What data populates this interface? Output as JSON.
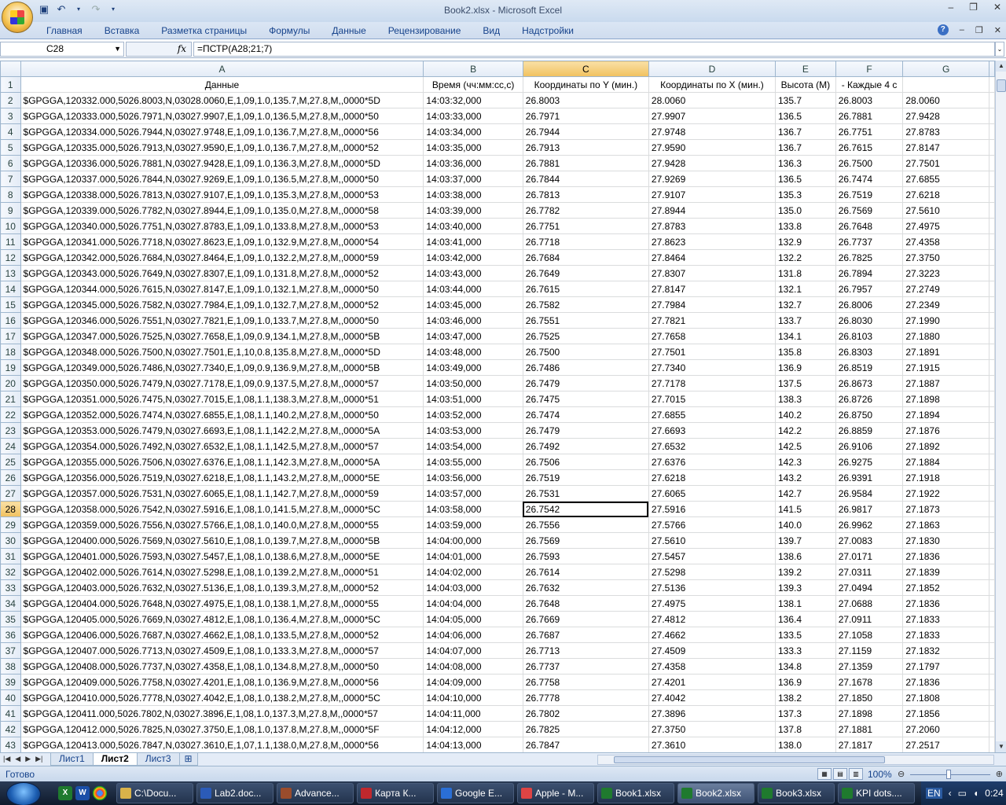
{
  "window": {
    "title": "Book2.xlsx - Microsoft Excel"
  },
  "ribbon": {
    "tabs": [
      "Главная",
      "Вставка",
      "Разметка страницы",
      "Формулы",
      "Данные",
      "Рецензирование",
      "Вид",
      "Надстройки"
    ]
  },
  "formula_bar": {
    "name_box": "C28",
    "fx_label": "fx",
    "formula": "=ПСТР(A28;21;7)"
  },
  "grid": {
    "columns": [
      "A",
      "B",
      "C",
      "D",
      "E",
      "F",
      "G"
    ],
    "selected_column": "C",
    "selected_row": "28",
    "header_row": [
      "Данные",
      "Время (чч:мм:сс,с)",
      "Координаты по Y (мин.)",
      "Координаты по X (мин.)",
      "Высота (М)",
      "- Каждые 4 с",
      ""
    ],
    "rows": [
      [
        "2",
        "$GPGGA,120332.000,5026.8003,N,03028.0060,E,1,09,1.0,135.7,M,27.8,M,,0000*5D",
        "14:03:32,000",
        "26.8003",
        "28.0060",
        "135.7",
        "26.8003",
        "28.0060"
      ],
      [
        "3",
        "$GPGGA,120333.000,5026.7971,N,03027.9907,E,1,09,1.0,136.5,M,27.8,M,,0000*50",
        "14:03:33,000",
        "26.7971",
        "27.9907",
        "136.5",
        "26.7881",
        "27.9428"
      ],
      [
        "4",
        "$GPGGA,120334.000,5026.7944,N,03027.9748,E,1,09,1.0,136.7,M,27.8,M,,0000*56",
        "14:03:34,000",
        "26.7944",
        "27.9748",
        "136.7",
        "26.7751",
        "27.8783"
      ],
      [
        "5",
        "$GPGGA,120335.000,5026.7913,N,03027.9590,E,1,09,1.0,136.7,M,27.8,M,,0000*52",
        "14:03:35,000",
        "26.7913",
        "27.9590",
        "136.7",
        "26.7615",
        "27.8147"
      ],
      [
        "6",
        "$GPGGA,120336.000,5026.7881,N,03027.9428,E,1,09,1.0,136.3,M,27.8,M,,0000*5D",
        "14:03:36,000",
        "26.7881",
        "27.9428",
        "136.3",
        "26.7500",
        "27.7501"
      ],
      [
        "7",
        "$GPGGA,120337.000,5026.7844,N,03027.9269,E,1,09,1.0,136.5,M,27.8,M,,0000*50",
        "14:03:37,000",
        "26.7844",
        "27.9269",
        "136.5",
        "26.7474",
        "27.6855"
      ],
      [
        "8",
        "$GPGGA,120338.000,5026.7813,N,03027.9107,E,1,09,1.0,135.3,M,27.8,M,,0000*53",
        "14:03:38,000",
        "26.7813",
        "27.9107",
        "135.3",
        "26.7519",
        "27.6218"
      ],
      [
        "9",
        "$GPGGA,120339.000,5026.7782,N,03027.8944,E,1,09,1.0,135.0,M,27.8,M,,0000*58",
        "14:03:39,000",
        "26.7782",
        "27.8944",
        "135.0",
        "26.7569",
        "27.5610"
      ],
      [
        "10",
        "$GPGGA,120340.000,5026.7751,N,03027.8783,E,1,09,1.0,133.8,M,27.8,M,,0000*53",
        "14:03:40,000",
        "26.7751",
        "27.8783",
        "133.8",
        "26.7648",
        "27.4975"
      ],
      [
        "11",
        "$GPGGA,120341.000,5026.7718,N,03027.8623,E,1,09,1.0,132.9,M,27.8,M,,0000*54",
        "14:03:41,000",
        "26.7718",
        "27.8623",
        "132.9",
        "26.7737",
        "27.4358"
      ],
      [
        "12",
        "$GPGGA,120342.000,5026.7684,N,03027.8464,E,1,09,1.0,132.2,M,27.8,M,,0000*59",
        "14:03:42,000",
        "26.7684",
        "27.8464",
        "132.2",
        "26.7825",
        "27.3750"
      ],
      [
        "13",
        "$GPGGA,120343.000,5026.7649,N,03027.8307,E,1,09,1.0,131.8,M,27.8,M,,0000*52",
        "14:03:43,000",
        "26.7649",
        "27.8307",
        "131.8",
        "26.7894",
        "27.3223"
      ],
      [
        "14",
        "$GPGGA,120344.000,5026.7615,N,03027.8147,E,1,09,1.0,132.1,M,27.8,M,,0000*50",
        "14:03:44,000",
        "26.7615",
        "27.8147",
        "132.1",
        "26.7957",
        "27.2749"
      ],
      [
        "15",
        "$GPGGA,120345.000,5026.7582,N,03027.7984,E,1,09,1.0,132.7,M,27.8,M,,0000*52",
        "14:03:45,000",
        "26.7582",
        "27.7984",
        "132.7",
        "26.8006",
        "27.2349"
      ],
      [
        "16",
        "$GPGGA,120346.000,5026.7551,N,03027.7821,E,1,09,1.0,133.7,M,27.8,M,,0000*50",
        "14:03:46,000",
        "26.7551",
        "27.7821",
        "133.7",
        "26.8030",
        "27.1990"
      ],
      [
        "17",
        "$GPGGA,120347.000,5026.7525,N,03027.7658,E,1,09,0.9,134.1,M,27.8,M,,0000*5B",
        "14:03:47,000",
        "26.7525",
        "27.7658",
        "134.1",
        "26.8103",
        "27.1880"
      ],
      [
        "18",
        "$GPGGA,120348.000,5026.7500,N,03027.7501,E,1,10,0.8,135.8,M,27.8,M,,0000*5D",
        "14:03:48,000",
        "26.7500",
        "27.7501",
        "135.8",
        "26.8303",
        "27.1891"
      ],
      [
        "19",
        "$GPGGA,120349.000,5026.7486,N,03027.7340,E,1,09,0.9,136.9,M,27.8,M,,0000*5B",
        "14:03:49,000",
        "26.7486",
        "27.7340",
        "136.9",
        "26.8519",
        "27.1915"
      ],
      [
        "20",
        "$GPGGA,120350.000,5026.7479,N,03027.7178,E,1,09,0.9,137.5,M,27.8,M,,0000*57",
        "14:03:50,000",
        "26.7479",
        "27.7178",
        "137.5",
        "26.8673",
        "27.1887"
      ],
      [
        "21",
        "$GPGGA,120351.000,5026.7475,N,03027.7015,E,1,08,1.1,138.3,M,27.8,M,,0000*51",
        "14:03:51,000",
        "26.7475",
        "27.7015",
        "138.3",
        "26.8726",
        "27.1898"
      ],
      [
        "22",
        "$GPGGA,120352.000,5026.7474,N,03027.6855,E,1,08,1.1,140.2,M,27.8,M,,0000*50",
        "14:03:52,000",
        "26.7474",
        "27.6855",
        "140.2",
        "26.8750",
        "27.1894"
      ],
      [
        "23",
        "$GPGGA,120353.000,5026.7479,N,03027.6693,E,1,08,1.1,142.2,M,27.8,M,,0000*5A",
        "14:03:53,000",
        "26.7479",
        "27.6693",
        "142.2",
        "26.8859",
        "27.1876"
      ],
      [
        "24",
        "$GPGGA,120354.000,5026.7492,N,03027.6532,E,1,08,1.1,142.5,M,27.8,M,,0000*57",
        "14:03:54,000",
        "26.7492",
        "27.6532",
        "142.5",
        "26.9106",
        "27.1892"
      ],
      [
        "25",
        "$GPGGA,120355.000,5026.7506,N,03027.6376,E,1,08,1.1,142.3,M,27.8,M,,0000*5A",
        "14:03:55,000",
        "26.7506",
        "27.6376",
        "142.3",
        "26.9275",
        "27.1884"
      ],
      [
        "26",
        "$GPGGA,120356.000,5026.7519,N,03027.6218,E,1,08,1.1,143.2,M,27.8,M,,0000*5E",
        "14:03:56,000",
        "26.7519",
        "27.6218",
        "143.2",
        "26.9391",
        "27.1918"
      ],
      [
        "27",
        "$GPGGA,120357.000,5026.7531,N,03027.6065,E,1,08,1.1,142.7,M,27.8,M,,0000*59",
        "14:03:57,000",
        "26.7531",
        "27.6065",
        "142.7",
        "26.9584",
        "27.1922"
      ],
      [
        "28",
        "$GPGGA,120358.000,5026.7542,N,03027.5916,E,1,08,1.0,141.5,M,27.8,M,,0000*5C",
        "14:03:58,000",
        "26.7542",
        "27.5916",
        "141.5",
        "26.9817",
        "27.1873"
      ],
      [
        "29",
        "$GPGGA,120359.000,5026.7556,N,03027.5766,E,1,08,1.0,140.0,M,27.8,M,,0000*55",
        "14:03:59,000",
        "26.7556",
        "27.5766",
        "140.0",
        "26.9962",
        "27.1863"
      ],
      [
        "30",
        "$GPGGA,120400.000,5026.7569,N,03027.5610,E,1,08,1.0,139.7,M,27.8,M,,0000*5B",
        "14:04:00,000",
        "26.7569",
        "27.5610",
        "139.7",
        "27.0083",
        "27.1830"
      ],
      [
        "31",
        "$GPGGA,120401.000,5026.7593,N,03027.5457,E,1,08,1.0,138.6,M,27.8,M,,0000*5E",
        "14:04:01,000",
        "26.7593",
        "27.5457",
        "138.6",
        "27.0171",
        "27.1836"
      ],
      [
        "32",
        "$GPGGA,120402.000,5026.7614,N,03027.5298,E,1,08,1.0,139.2,M,27.8,M,,0000*51",
        "14:04:02,000",
        "26.7614",
        "27.5298",
        "139.2",
        "27.0311",
        "27.1839"
      ],
      [
        "33",
        "$GPGGA,120403.000,5026.7632,N,03027.5136,E,1,08,1.0,139.3,M,27.8,M,,0000*52",
        "14:04:03,000",
        "26.7632",
        "27.5136",
        "139.3",
        "27.0494",
        "27.1852"
      ],
      [
        "34",
        "$GPGGA,120404.000,5026.7648,N,03027.4975,E,1,08,1.0,138.1,M,27.8,M,,0000*55",
        "14:04:04,000",
        "26.7648",
        "27.4975",
        "138.1",
        "27.0688",
        "27.1836"
      ],
      [
        "35",
        "$GPGGA,120405.000,5026.7669,N,03027.4812,E,1,08,1.0,136.4,M,27.8,M,,0000*5C",
        "14:04:05,000",
        "26.7669",
        "27.4812",
        "136.4",
        "27.0911",
        "27.1833"
      ],
      [
        "36",
        "$GPGGA,120406.000,5026.7687,N,03027.4662,E,1,08,1.0,133.5,M,27.8,M,,0000*52",
        "14:04:06,000",
        "26.7687",
        "27.4662",
        "133.5",
        "27.1058",
        "27.1833"
      ],
      [
        "37",
        "$GPGGA,120407.000,5026.7713,N,03027.4509,E,1,08,1.0,133.3,M,27.8,M,,0000*57",
        "14:04:07,000",
        "26.7713",
        "27.4509",
        "133.3",
        "27.1159",
        "27.1832"
      ],
      [
        "38",
        "$GPGGA,120408.000,5026.7737,N,03027.4358,E,1,08,1.0,134.8,M,27.8,M,,0000*50",
        "14:04:08,000",
        "26.7737",
        "27.4358",
        "134.8",
        "27.1359",
        "27.1797"
      ],
      [
        "39",
        "$GPGGA,120409.000,5026.7758,N,03027.4201,E,1,08,1.0,136.9,M,27.8,M,,0000*56",
        "14:04:09,000",
        "26.7758",
        "27.4201",
        "136.9",
        "27.1678",
        "27.1836"
      ],
      [
        "40",
        "$GPGGA,120410.000,5026.7778,N,03027.4042,E,1,08,1.0,138.2,M,27.8,M,,0000*5C",
        "14:04:10,000",
        "26.7778",
        "27.4042",
        "138.2",
        "27.1850",
        "27.1808"
      ],
      [
        "41",
        "$GPGGA,120411.000,5026.7802,N,03027.3896,E,1,08,1.0,137.3,M,27.8,M,,0000*57",
        "14:04:11,000",
        "26.7802",
        "27.3896",
        "137.3",
        "27.1898",
        "27.1856"
      ],
      [
        "42",
        "$GPGGA,120412.000,5026.7825,N,03027.3750,E,1,08,1.0,137.8,M,27.8,M,,0000*5F",
        "14:04:12,000",
        "26.7825",
        "27.3750",
        "137.8",
        "27.1881",
        "27.2060"
      ],
      [
        "43",
        "$GPGGA,120413.000,5026.7847,N,03027.3610,E,1,07,1.1,138.0,M,27.8,M,,0000*56",
        "14:04:13,000",
        "26.7847",
        "27.3610",
        "138.0",
        "27.1817",
        "27.2517"
      ]
    ]
  },
  "sheets": {
    "tabs": [
      "Лист1",
      "Лист2",
      "Лист3"
    ],
    "active": "Лист2"
  },
  "statusbar": {
    "status": "Готово",
    "zoom": "100%"
  },
  "taskbar": {
    "tasks": [
      "C:\\Docu...",
      "Lab2.doc...",
      "Advance...",
      "Карта К...",
      "Google E...",
      "Apple - M...",
      "Book1.xlsx",
      "Book2.xlsx",
      "Book3.xlsx",
      "KPI dots...."
    ],
    "active_task": "Book2.xlsx",
    "language": "EN",
    "clock": "0:24"
  }
}
